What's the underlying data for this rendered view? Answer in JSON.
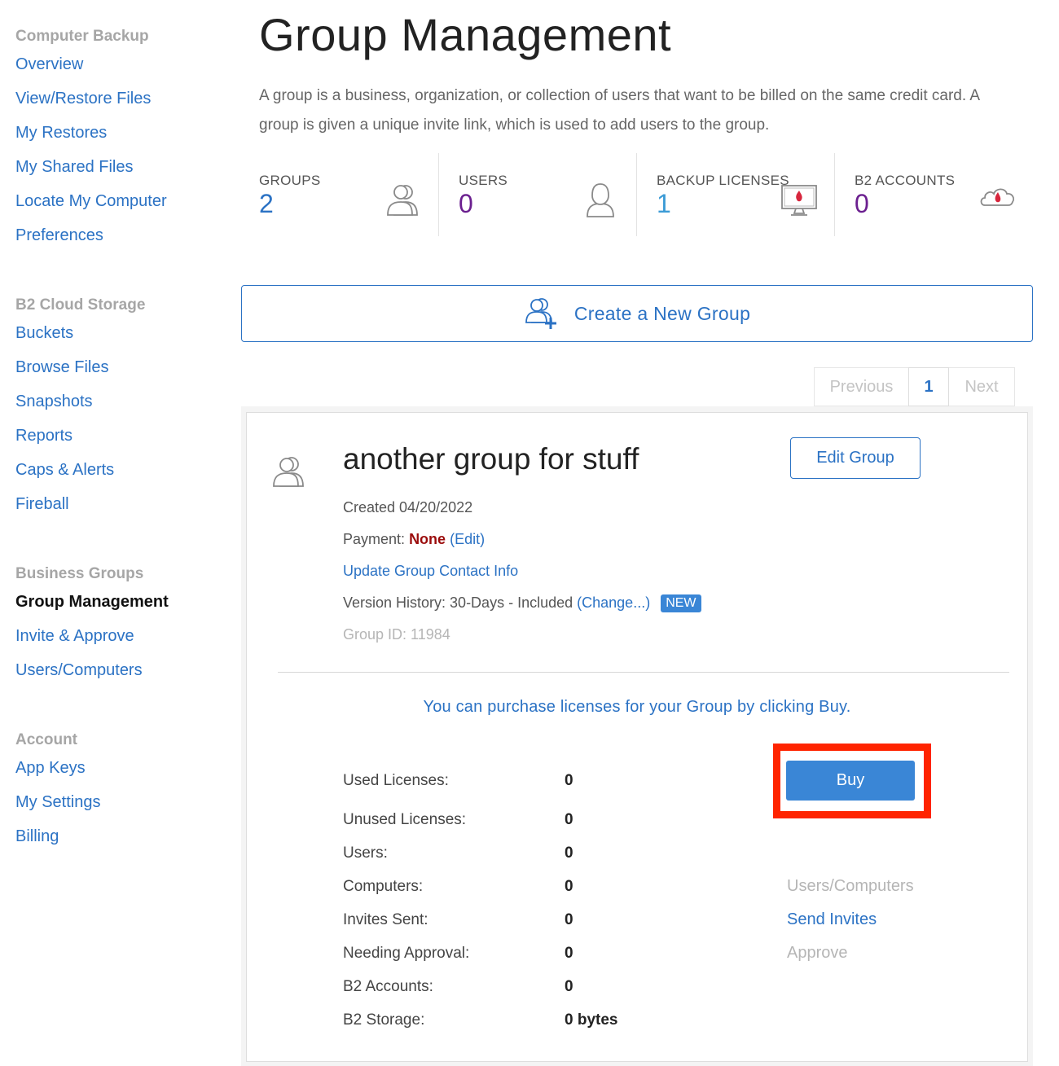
{
  "sidebar": {
    "sections": [
      {
        "heading": "Computer Backup",
        "items": [
          "Overview",
          "View/Restore Files",
          "My Restores",
          "My Shared Files",
          "Locate My Computer",
          "Preferences"
        ]
      },
      {
        "heading": "B2 Cloud Storage",
        "items": [
          "Buckets",
          "Browse Files",
          "Snapshots",
          "Reports",
          "Caps & Alerts",
          "Fireball"
        ]
      },
      {
        "heading": "Business Groups",
        "items": [
          "Group Management",
          "Invite & Approve",
          "Users/Computers"
        ]
      },
      {
        "heading": "Account",
        "items": [
          "App Keys",
          "My Settings",
          "Billing"
        ]
      }
    ],
    "active_item": "Group Management"
  },
  "page": {
    "title": "Group Management",
    "description": "A group is a business, organization, or collection of users that want to be billed on the same credit card. A group is given a unique invite link, which is used to add users to the group."
  },
  "stats": [
    {
      "label": "GROUPS",
      "value": "2",
      "icon": "users-icon"
    },
    {
      "label": "USERS",
      "value": "0",
      "icon": "user-icon"
    },
    {
      "label": "BACKUP LICENSES",
      "value": "1",
      "icon": "monitor-flame-icon"
    },
    {
      "label": "B2 ACCOUNTS",
      "value": "0",
      "icon": "cloud-flame-icon"
    }
  ],
  "create_group": {
    "label": "Create a New Group"
  },
  "pagination": {
    "previous": "Previous",
    "current": "1",
    "next": "Next"
  },
  "group": {
    "name": "another group for stuff",
    "edit_label": "Edit Group",
    "created": "Created 04/20/2022",
    "payment_label": "Payment:",
    "payment_value": "None",
    "payment_edit": "(Edit)",
    "update_contact": "Update Group Contact Info",
    "version_history_label": "Version History: 30-Days - Included",
    "version_history_change": "(Change...)",
    "version_history_badge": "NEW",
    "group_id": "Group ID: 11984",
    "purchase_message": "You can purchase licenses for your Group by clicking Buy.",
    "buy_label": "Buy",
    "stats": [
      {
        "label": "Used Licenses:",
        "value": "0"
      },
      {
        "label": "Unused Licenses:",
        "value": "0"
      },
      {
        "label": "Users:",
        "value": "0"
      },
      {
        "label": "Computers:",
        "value": "0"
      },
      {
        "label": "Invites Sent:",
        "value": "0"
      },
      {
        "label": "Needing Approval:",
        "value": "0"
      },
      {
        "label": "B2 Accounts:",
        "value": "0"
      },
      {
        "label": "B2 Storage:",
        "value": "0 bytes"
      }
    ],
    "actions": {
      "users_computers": "Users/Computers",
      "send_invites": "Send Invites",
      "approve": "Approve"
    }
  }
}
